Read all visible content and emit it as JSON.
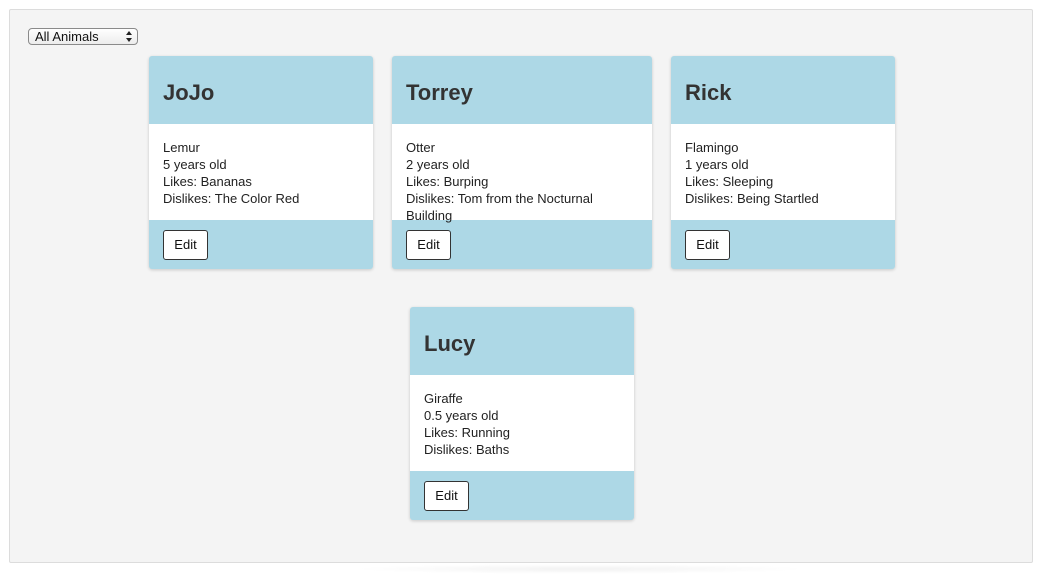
{
  "filter": {
    "selected": "All Animals"
  },
  "animals": [
    {
      "name": "JoJo",
      "species": "Lemur",
      "age": "5 years old",
      "likes": "Likes: Bananas",
      "dislikes": "Dislikes: The Color Red",
      "edit_label": "Edit"
    },
    {
      "name": "Torrey",
      "species": "Otter",
      "age": "2 years old",
      "likes": "Likes: Burping",
      "dislikes": "Dislikes: Tom from the Nocturnal Building",
      "edit_label": "Edit"
    },
    {
      "name": "Rick",
      "species": "Flamingo",
      "age": "1 years old",
      "likes": "Likes: Sleeping",
      "dislikes": "Dislikes: Being Startled",
      "edit_label": "Edit"
    },
    {
      "name": "Lucy",
      "species": "Giraffe",
      "age": "0.5 years old",
      "likes": "Likes: Running",
      "dislikes": "Dislikes: Baths",
      "edit_label": "Edit"
    }
  ],
  "colors": {
    "card_accent": "#add8e6",
    "card_body": "#ffffff",
    "page_background": "#f4f4f4"
  },
  "icons": {
    "filter_arrows": "select-arrows-icon"
  }
}
